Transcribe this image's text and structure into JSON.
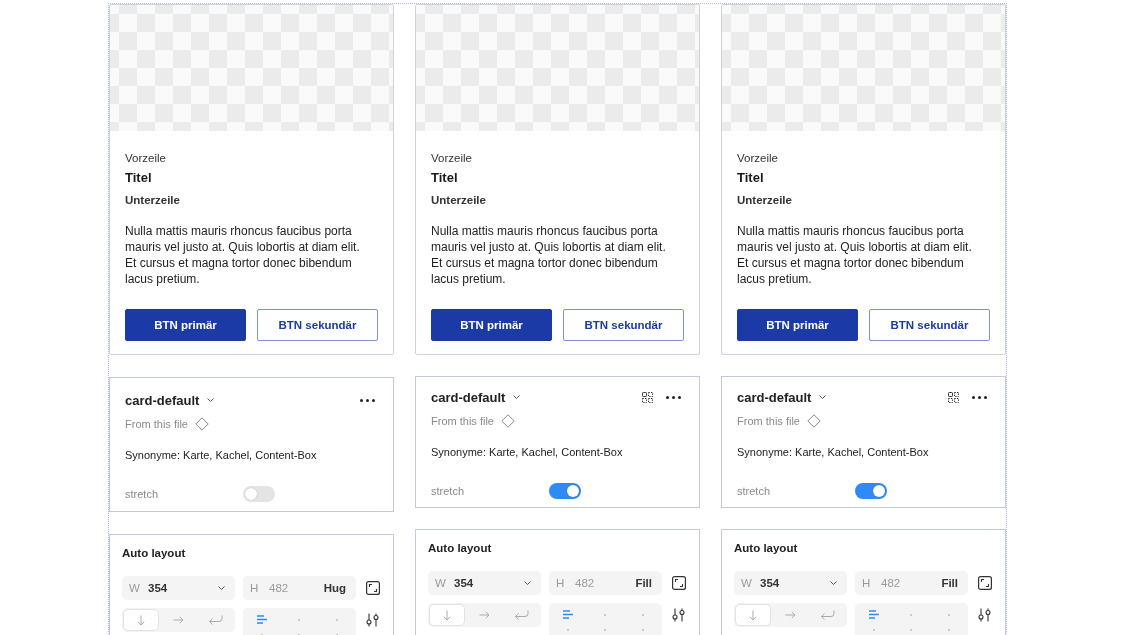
{
  "columns": [
    {
      "card": {
        "overline": "Vorzeile",
        "title": "Titel",
        "subtitle": "Unterzeile",
        "body": "Nulla mattis mauris rhoncus faucibus porta mauris vel justo at. Quis lobortis at diam elit. Et cursus et magna tortor donec bibendum lacus pretium.",
        "buttons": [
          {
            "label": "BTN primär",
            "kind": "primary"
          },
          {
            "label": "BTN sekundär",
            "kind": "secondary"
          }
        ]
      },
      "component_panel": {
        "name": "card-default",
        "source": "From this file",
        "variants_icon": false,
        "description": "Synonyme: Karte, Kachel, Content-Box",
        "property": {
          "label": "stretch",
          "on": false
        }
      },
      "auto_layout": {
        "title": "Auto layout",
        "width": {
          "label": "W",
          "value": "354"
        },
        "height": {
          "label": "H",
          "value": "482",
          "disabled": true,
          "mode": "Hug"
        },
        "direction": [
          {
            "kind": "down",
            "selected": true
          },
          {
            "kind": "right",
            "selected": false
          },
          {
            "kind": "wrap",
            "selected": false
          }
        ],
        "alignment": [
          {
            "selected": true
          },
          {
            "selected": false
          },
          {
            "selected": false
          },
          {
            "selected": false
          },
          {
            "selected": false
          },
          {
            "selected": false
          }
        ]
      }
    },
    {
      "card": {
        "overline": "Vorzeile",
        "title": "Titel",
        "subtitle": "Unterzeile",
        "body": "Nulla mattis mauris rhoncus faucibus porta mauris vel justo at. Quis lobortis at diam elit. Et cursus et magna tortor donec bibendum lacus pretium.",
        "buttons": [
          {
            "label": "BTN primär",
            "kind": "primary"
          },
          {
            "label": "BTN sekundär",
            "kind": "secondary"
          }
        ]
      },
      "component_panel": {
        "name": "card-default",
        "source": "From this file",
        "variants_icon": true,
        "description": "Synonyme: Karte, Kachel, Content-Box",
        "property": {
          "label": "stretch",
          "on": true
        }
      },
      "auto_layout": {
        "title": "Auto layout",
        "width": {
          "label": "W",
          "value": "354"
        },
        "height": {
          "label": "H",
          "value": "482",
          "disabled": true,
          "mode": "Fill"
        },
        "direction": [
          {
            "kind": "down",
            "selected": true
          },
          {
            "kind": "right",
            "selected": false
          },
          {
            "kind": "wrap",
            "selected": false
          }
        ],
        "alignment": [
          {
            "selected": true
          },
          {
            "selected": false
          },
          {
            "selected": false
          },
          {
            "selected": false
          },
          {
            "selected": false
          },
          {
            "selected": false
          }
        ]
      }
    },
    {
      "card": {
        "overline": "Vorzeile",
        "title": "Titel",
        "subtitle": "Unterzeile",
        "body": "Nulla mattis mauris rhoncus faucibus porta mauris vel justo at. Quis lobortis at diam elit. Et cursus et magna tortor donec bibendum lacus pretium.",
        "buttons": [
          {
            "label": "BTN primär",
            "kind": "primary"
          },
          {
            "label": "BTN sekundär",
            "kind": "secondary"
          }
        ]
      },
      "component_panel": {
        "name": "card-default",
        "source": "From this file",
        "variants_icon": true,
        "description": "Synonyme: Karte, Kachel, Content-Box",
        "property": {
          "label": "stretch",
          "on": true
        }
      },
      "auto_layout": {
        "title": "Auto layout",
        "width": {
          "label": "W",
          "value": "354"
        },
        "height": {
          "label": "H",
          "value": "482",
          "disabled": true,
          "mode": "Fill"
        },
        "direction": [
          {
            "kind": "down",
            "selected": true
          },
          {
            "kind": "right",
            "selected": false
          },
          {
            "kind": "wrap",
            "selected": false
          }
        ],
        "alignment": [
          {
            "selected": true
          },
          {
            "selected": false
          },
          {
            "selected": false
          },
          {
            "selected": false
          },
          {
            "selected": false
          },
          {
            "selected": false
          }
        ]
      }
    }
  ]
}
